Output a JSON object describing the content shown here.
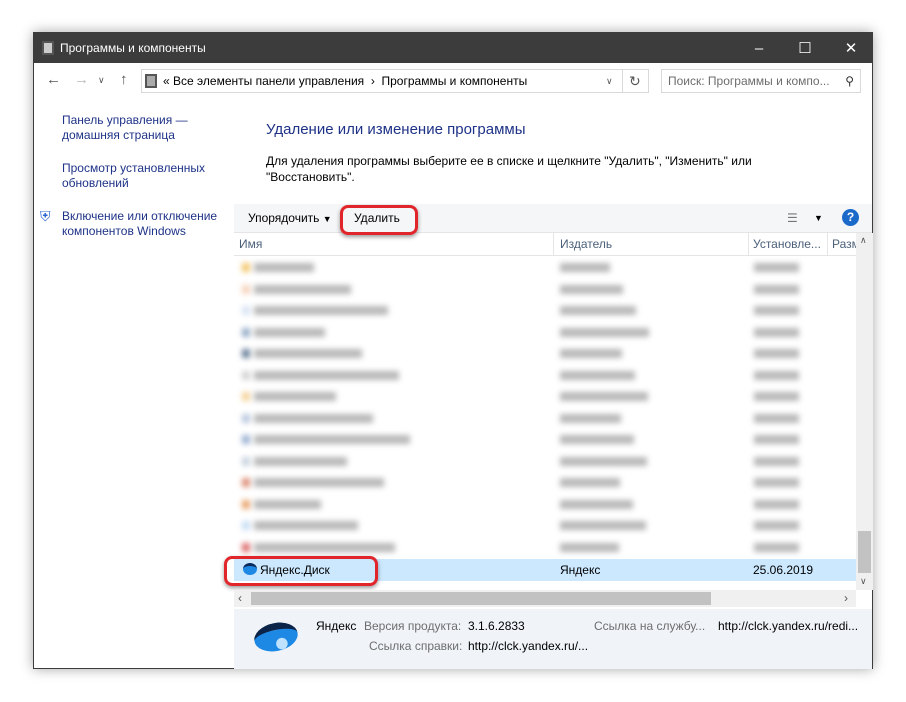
{
  "window": {
    "title": "Программы и компоненты"
  },
  "nav": {
    "breadcrumb_prefix": "«",
    "crumb1": "Все элементы панели управления",
    "sep": "›",
    "crumb2": "Программы и компоненты",
    "search_placeholder": "Поиск: Программы и компо..."
  },
  "sidebar": {
    "items": [
      {
        "label": "Панель управления — домашняя страница"
      },
      {
        "label": "Просмотр установленных обновлений"
      },
      {
        "label": "Включение или отключение компонентов Windows"
      }
    ]
  },
  "main": {
    "title": "Удаление или изменение программы",
    "description": "Для удаления программы выберите ее в списке и щелкните \"Удалить\", \"Изменить\" или \"Восстановить\"."
  },
  "toolbar": {
    "organize": "Упорядочить",
    "uninstall": "Удалить",
    "help": "?"
  },
  "table": {
    "columns": [
      "Имя",
      "Издатель",
      "Установле...",
      "Разм"
    ],
    "selected": {
      "name": "Яндекс.Диск",
      "publisher": "Яндекс",
      "installed": "25.06.2019"
    }
  },
  "details": {
    "publisher": "Яндекс",
    "version_label": "Версия продукта:",
    "version": "3.1.6.2833",
    "support_label": "Ссылка на службу...",
    "support_url": "http://clck.yandex.ru/redi...",
    "help_label": "Ссылка справки:",
    "help_url": "http://clck.yandex.ru/..."
  }
}
